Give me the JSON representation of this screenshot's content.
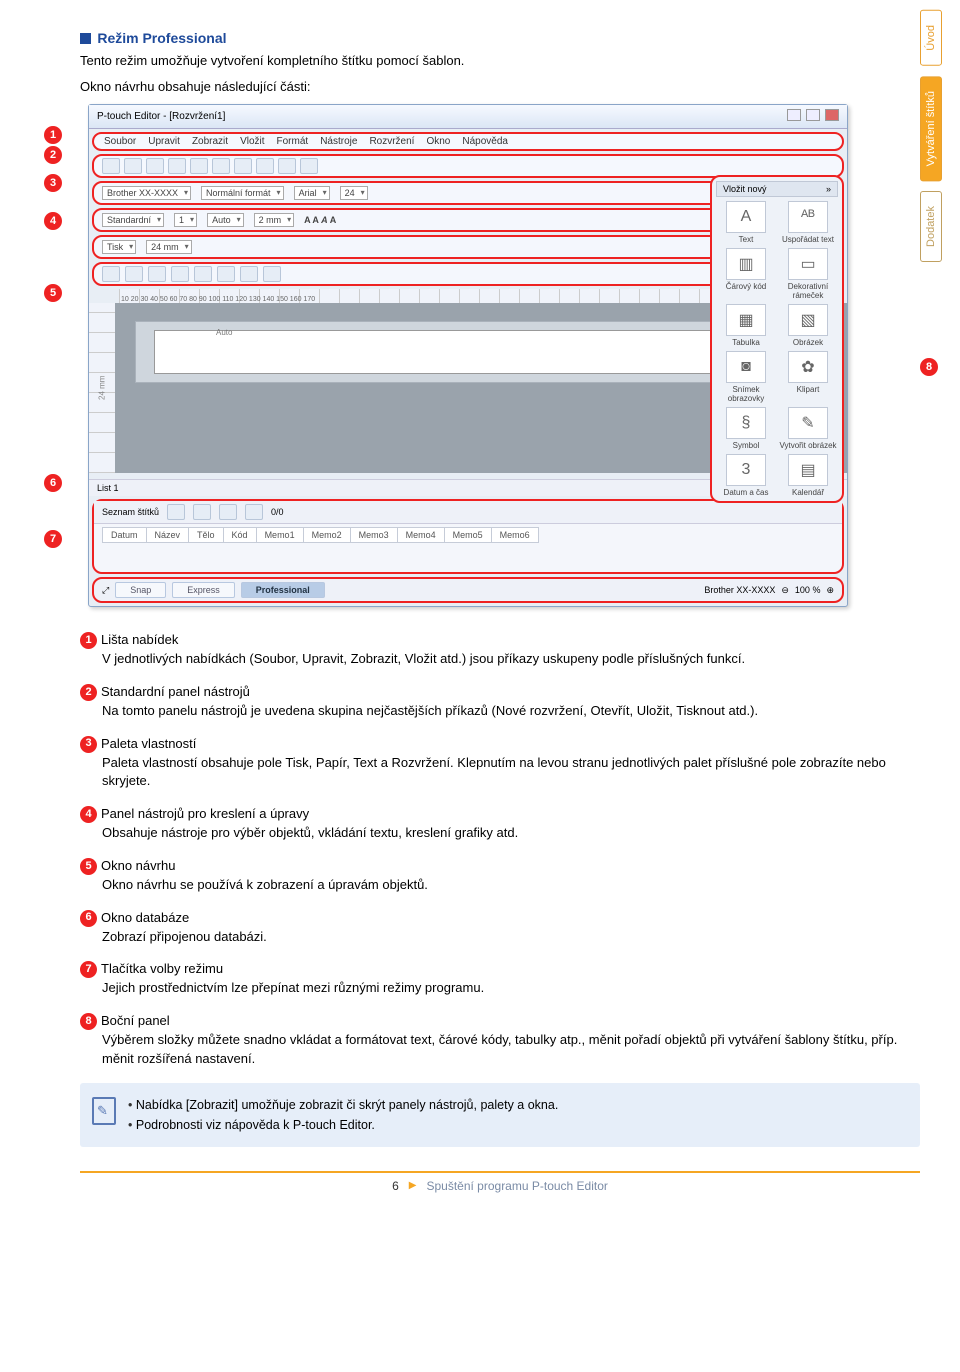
{
  "header": {
    "title": "Režim Professional",
    "intro1": "Tento režim umožňuje vytvoření kompletního štítku pomocí šablon.",
    "intro2": "Okno návrhu obsahuje následující části:"
  },
  "side_tabs": {
    "t1": "Úvod",
    "t2": "Vytváření štítků",
    "t3": "Dodatek"
  },
  "shot": {
    "title": "P-touch Editor - [Rozvržení1]",
    "menus": [
      "Soubor",
      "Upravit",
      "Zobrazit",
      "Vložit",
      "Formát",
      "Nástroje",
      "Rozvržení",
      "Okno",
      "Nápověda"
    ],
    "printer": "Brother XX-XXXX",
    "format_label": "Normální formát",
    "font": "Arial",
    "fontsize": "24",
    "std": "Standardní",
    "std_num": "1",
    "auto": "Auto",
    "size": "2 mm",
    "tisk": "Tisk",
    "width": "24 mm",
    "canvas_width": "24 mm",
    "canvas_auto": "Auto",
    "insert_head": "Vložit nový",
    "side_items": [
      {
        "icon": "A",
        "label": "Text"
      },
      {
        "icon": "ᴬᴮ",
        "label": "Uspořádat text"
      },
      {
        "icon": "▥",
        "label": "Čárový kód"
      },
      {
        "icon": "▭",
        "label": "Dekorativní rámeček"
      },
      {
        "icon": "▦",
        "label": "Tabulka"
      },
      {
        "icon": "▧",
        "label": "Obrázek"
      },
      {
        "icon": "◙",
        "label": "Snímek obrazovky"
      },
      {
        "icon": "✿",
        "label": "Klipart"
      },
      {
        "icon": "§",
        "label": "Symbol"
      },
      {
        "icon": "✎",
        "label": "Vytvořit obrázek"
      },
      {
        "icon": "3",
        "label": "Datum a čas"
      },
      {
        "icon": "▤",
        "label": "Kalendář"
      }
    ],
    "list_tab": "List 1",
    "db_label": "Seznam štítků",
    "db_nav": "0/0",
    "db_cols": [
      "Datum",
      "Název",
      "Tělo",
      "Kód",
      "Memo1",
      "Memo2",
      "Memo3",
      "Memo4",
      "Memo5",
      "Memo6"
    ],
    "mode_snap": "Snap",
    "mode_express": "Express",
    "mode_pro": "Professional",
    "zoom_printer": "Brother XX-XXXX",
    "zoom": "100 %"
  },
  "markers": {
    "m1": "1",
    "m2": "2",
    "m3": "3",
    "m4": "4",
    "m5": "5",
    "m6": "6",
    "m7": "7",
    "m8": "8"
  },
  "legend": [
    {
      "n": "1",
      "t": "Lišta nabídek",
      "b": "V jednotlivých nabídkách (Soubor, Upravit, Zobrazit, Vložit atd.) jsou příkazy uskupeny podle příslušných funkcí."
    },
    {
      "n": "2",
      "t": "Standardní panel nástrojů",
      "b": "Na tomto panelu nástrojů je uvedena skupina nejčastějších příkazů (Nové rozvržení, Otevřít, Uložit, Tisknout atd.)."
    },
    {
      "n": "3",
      "t": "Paleta vlastností",
      "b": "Paleta vlastností obsahuje pole Tisk, Papír, Text a Rozvržení. Klepnutím na levou stranu jednotlivých palet příslušné pole zobrazíte nebo skryjete."
    },
    {
      "n": "4",
      "t": "Panel nástrojů pro kreslení a úpravy",
      "b": "Obsahuje nástroje pro výběr objektů, vkládání textu, kreslení grafiky atd."
    },
    {
      "n": "5",
      "t": "Okno návrhu",
      "b": "Okno návrhu se používá k zobrazení a úpravám objektů."
    },
    {
      "n": "6",
      "t": "Okno databáze",
      "b": "Zobrazí připojenou databázi."
    },
    {
      "n": "7",
      "t": "Tlačítka volby režimu",
      "b": "Jejich prostřednictvím lze přepínat mezi různými režimy programu."
    },
    {
      "n": "8",
      "t": "Boční panel",
      "b": "Výběrem složky můžete snadno vkládat a formátovat text, čárové kódy, tabulky atp., měnit pořadí objektů při vytváření šablony štítku, příp. měnit rozšířená nastavení."
    }
  ],
  "note": {
    "l1": "Nabídka [Zobrazit] umožňuje zobrazit či skrýt panely nástrojů, palety a okna.",
    "l2": "Podrobnosti viz nápověda k P-touch Editor."
  },
  "footer": {
    "page": "6",
    "crumb": "Spuštění programu P-touch Editor"
  }
}
